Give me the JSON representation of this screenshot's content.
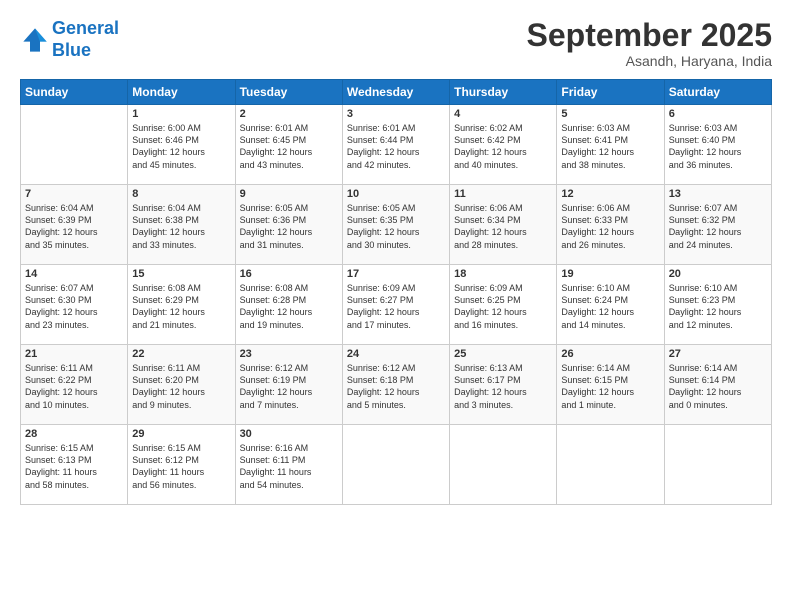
{
  "logo": {
    "line1": "General",
    "line2": "Blue"
  },
  "title": "September 2025",
  "location": "Asandh, Haryana, India",
  "header_days": [
    "Sunday",
    "Monday",
    "Tuesday",
    "Wednesday",
    "Thursday",
    "Friday",
    "Saturday"
  ],
  "weeks": [
    [
      {
        "day": "",
        "info": ""
      },
      {
        "day": "1",
        "info": "Sunrise: 6:00 AM\nSunset: 6:46 PM\nDaylight: 12 hours\nand 45 minutes."
      },
      {
        "day": "2",
        "info": "Sunrise: 6:01 AM\nSunset: 6:45 PM\nDaylight: 12 hours\nand 43 minutes."
      },
      {
        "day": "3",
        "info": "Sunrise: 6:01 AM\nSunset: 6:44 PM\nDaylight: 12 hours\nand 42 minutes."
      },
      {
        "day": "4",
        "info": "Sunrise: 6:02 AM\nSunset: 6:42 PM\nDaylight: 12 hours\nand 40 minutes."
      },
      {
        "day": "5",
        "info": "Sunrise: 6:03 AM\nSunset: 6:41 PM\nDaylight: 12 hours\nand 38 minutes."
      },
      {
        "day": "6",
        "info": "Sunrise: 6:03 AM\nSunset: 6:40 PM\nDaylight: 12 hours\nand 36 minutes."
      }
    ],
    [
      {
        "day": "7",
        "info": "Sunrise: 6:04 AM\nSunset: 6:39 PM\nDaylight: 12 hours\nand 35 minutes."
      },
      {
        "day": "8",
        "info": "Sunrise: 6:04 AM\nSunset: 6:38 PM\nDaylight: 12 hours\nand 33 minutes."
      },
      {
        "day": "9",
        "info": "Sunrise: 6:05 AM\nSunset: 6:36 PM\nDaylight: 12 hours\nand 31 minutes."
      },
      {
        "day": "10",
        "info": "Sunrise: 6:05 AM\nSunset: 6:35 PM\nDaylight: 12 hours\nand 30 minutes."
      },
      {
        "day": "11",
        "info": "Sunrise: 6:06 AM\nSunset: 6:34 PM\nDaylight: 12 hours\nand 28 minutes."
      },
      {
        "day": "12",
        "info": "Sunrise: 6:06 AM\nSunset: 6:33 PM\nDaylight: 12 hours\nand 26 minutes."
      },
      {
        "day": "13",
        "info": "Sunrise: 6:07 AM\nSunset: 6:32 PM\nDaylight: 12 hours\nand 24 minutes."
      }
    ],
    [
      {
        "day": "14",
        "info": "Sunrise: 6:07 AM\nSunset: 6:30 PM\nDaylight: 12 hours\nand 23 minutes."
      },
      {
        "day": "15",
        "info": "Sunrise: 6:08 AM\nSunset: 6:29 PM\nDaylight: 12 hours\nand 21 minutes."
      },
      {
        "day": "16",
        "info": "Sunrise: 6:08 AM\nSunset: 6:28 PM\nDaylight: 12 hours\nand 19 minutes."
      },
      {
        "day": "17",
        "info": "Sunrise: 6:09 AM\nSunset: 6:27 PM\nDaylight: 12 hours\nand 17 minutes."
      },
      {
        "day": "18",
        "info": "Sunrise: 6:09 AM\nSunset: 6:25 PM\nDaylight: 12 hours\nand 16 minutes."
      },
      {
        "day": "19",
        "info": "Sunrise: 6:10 AM\nSunset: 6:24 PM\nDaylight: 12 hours\nand 14 minutes."
      },
      {
        "day": "20",
        "info": "Sunrise: 6:10 AM\nSunset: 6:23 PM\nDaylight: 12 hours\nand 12 minutes."
      }
    ],
    [
      {
        "day": "21",
        "info": "Sunrise: 6:11 AM\nSunset: 6:22 PM\nDaylight: 12 hours\nand 10 minutes."
      },
      {
        "day": "22",
        "info": "Sunrise: 6:11 AM\nSunset: 6:20 PM\nDaylight: 12 hours\nand 9 minutes."
      },
      {
        "day": "23",
        "info": "Sunrise: 6:12 AM\nSunset: 6:19 PM\nDaylight: 12 hours\nand 7 minutes."
      },
      {
        "day": "24",
        "info": "Sunrise: 6:12 AM\nSunset: 6:18 PM\nDaylight: 12 hours\nand 5 minutes."
      },
      {
        "day": "25",
        "info": "Sunrise: 6:13 AM\nSunset: 6:17 PM\nDaylight: 12 hours\nand 3 minutes."
      },
      {
        "day": "26",
        "info": "Sunrise: 6:14 AM\nSunset: 6:15 PM\nDaylight: 12 hours\nand 1 minute."
      },
      {
        "day": "27",
        "info": "Sunrise: 6:14 AM\nSunset: 6:14 PM\nDaylight: 12 hours\nand 0 minutes."
      }
    ],
    [
      {
        "day": "28",
        "info": "Sunrise: 6:15 AM\nSunset: 6:13 PM\nDaylight: 11 hours\nand 58 minutes."
      },
      {
        "day": "29",
        "info": "Sunrise: 6:15 AM\nSunset: 6:12 PM\nDaylight: 11 hours\nand 56 minutes."
      },
      {
        "day": "30",
        "info": "Sunrise: 6:16 AM\nSunset: 6:11 PM\nDaylight: 11 hours\nand 54 minutes."
      },
      {
        "day": "",
        "info": ""
      },
      {
        "day": "",
        "info": ""
      },
      {
        "day": "",
        "info": ""
      },
      {
        "day": "",
        "info": ""
      }
    ]
  ]
}
